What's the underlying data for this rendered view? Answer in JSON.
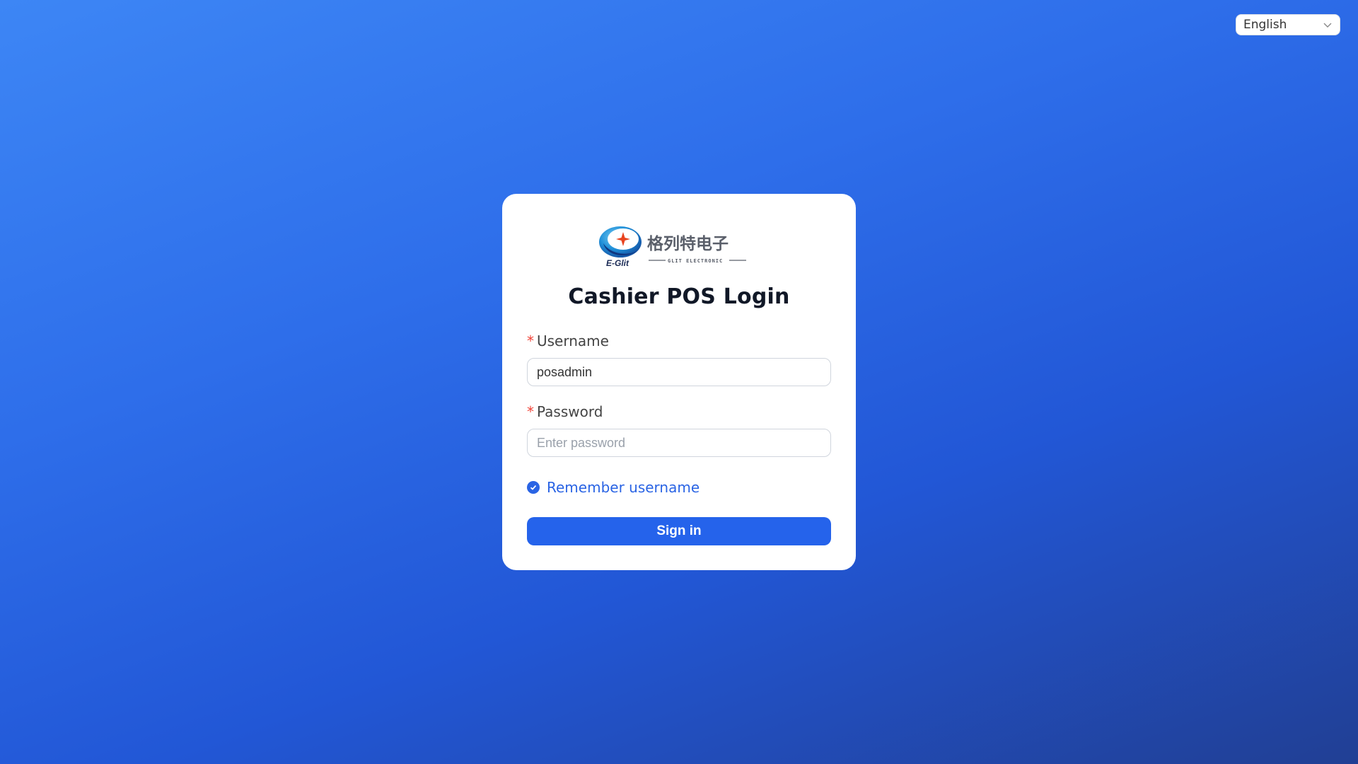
{
  "language_select": {
    "value": "English",
    "icon": "chevron-down-icon"
  },
  "logo": {
    "brand_en": "E-Glit",
    "brand_cn": "格列特电子",
    "tagline": "GLIT ELECTRONIC"
  },
  "login": {
    "title": "Cashier POS Login",
    "username_label": "Username",
    "username_value": "posadmin",
    "password_label": "Password",
    "password_placeholder": "Enter password",
    "required_mark": "*",
    "remember_label": "Remember username",
    "remember_checked": true,
    "signin_label": "Sign in"
  },
  "colors": {
    "accent": "#2563eb",
    "required": "#f04438",
    "bg_top": "#3d86f5",
    "bg_bottom": "#213f94"
  }
}
